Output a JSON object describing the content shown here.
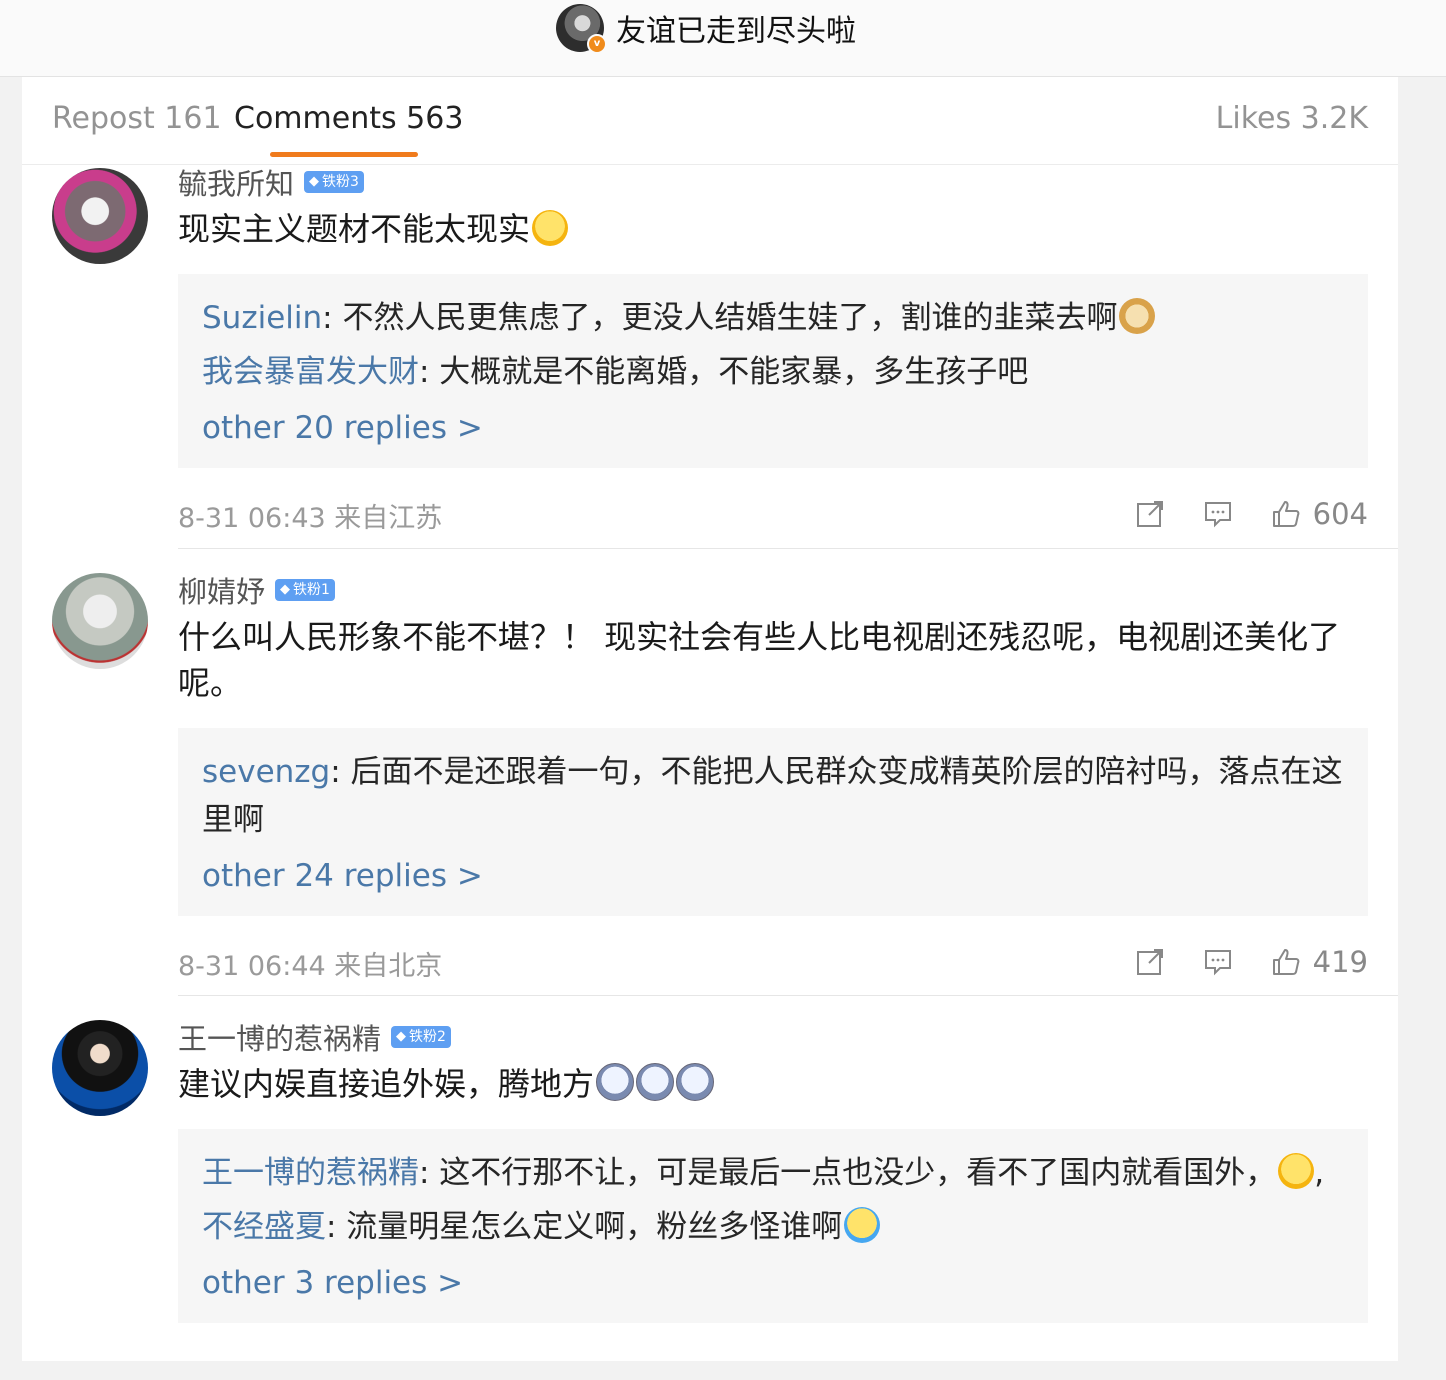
{
  "header": {
    "title": "友谊已走到尽头啦",
    "verified_mark": "v"
  },
  "tabs": {
    "repost": "Repost 161",
    "comments": "Comments 563",
    "likes": "Likes 3.2K"
  },
  "comments": [
    {
      "username": "毓我所知",
      "badge": "铁粉3",
      "text": "现实主义题材不能太现实",
      "text_emoji": "laugh-emoji",
      "replies": [
        {
          "name": "Suzielin",
          "text": ": 不然人民更焦虑了，更没人结婚生娃了，割谁的韭菜去啊"
        },
        {
          "name": "我会暴富发大财",
          "text": ": 大概就是不能离婚，不能家暴，多生孩子吧"
        }
      ],
      "more": "other 20 replies >",
      "time": "8-31 06:43 来自江苏",
      "likes": "604"
    },
    {
      "username": "柳婧妤",
      "badge": "铁粉1",
      "text": "什么叫人民形象不能不堪？！ 现实社会有些人比电视剧还残忍呢，电视剧还美化了呢。",
      "replies": [
        {
          "name": "sevenzg",
          "text": ": 后面不是还跟着一句，不能把人民群众变成精英阶层的陪衬吗，落点在这里啊"
        }
      ],
      "more": "other 24 replies >",
      "time": "8-31 06:44 来自北京",
      "likes": "419"
    },
    {
      "username": "王一博的惹祸精",
      "badge": "铁粉2",
      "text": "建议内娱直接追外娱，腾地方",
      "replies": [
        {
          "name": "王一博的惹祸精",
          "text": ": 这不行那不让，可是最后一点也没少，看不了国内就看国外，"
        },
        {
          "name": "不经盛夏",
          "text": ": 流量明星怎么定义啊，粉丝多怪谁啊"
        }
      ],
      "more": "other 3 replies >"
    }
  ]
}
